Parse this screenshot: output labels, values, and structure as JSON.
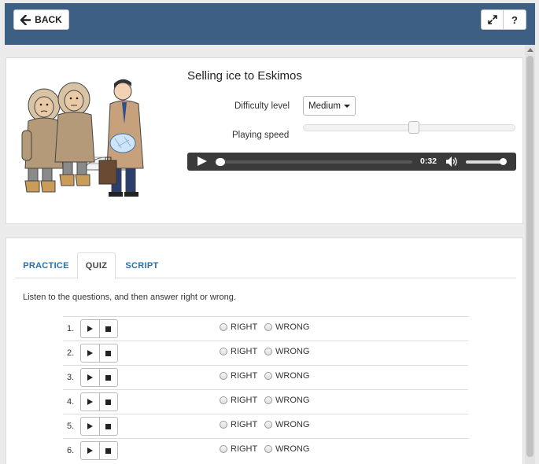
{
  "header": {
    "back_label": "BACK",
    "help_label": "?"
  },
  "lesson": {
    "title": "Selling ice to Eskimos",
    "difficulty_label": "Difficulty level",
    "difficulty_value": "Medium",
    "speed_label": "Playing speed",
    "speed_level": 0.52,
    "player_time": "0:32",
    "volume_level": 1.0
  },
  "tabs": [
    {
      "label": "PRACTICE"
    },
    {
      "label": "QUIZ"
    },
    {
      "label": "SCRIPT"
    }
  ],
  "quiz": {
    "instructions": "Listen to the questions, and then answer right or wrong.",
    "right_label": "RIGHT",
    "wrong_label": "WRONG",
    "questions": [
      {
        "number": "1."
      },
      {
        "number": "2."
      },
      {
        "number": "3."
      },
      {
        "number": "4."
      },
      {
        "number": "5."
      },
      {
        "number": "6."
      }
    ]
  },
  "colors": {
    "header_bg": "#3c5f83",
    "tab_text": "#2a6fab"
  }
}
